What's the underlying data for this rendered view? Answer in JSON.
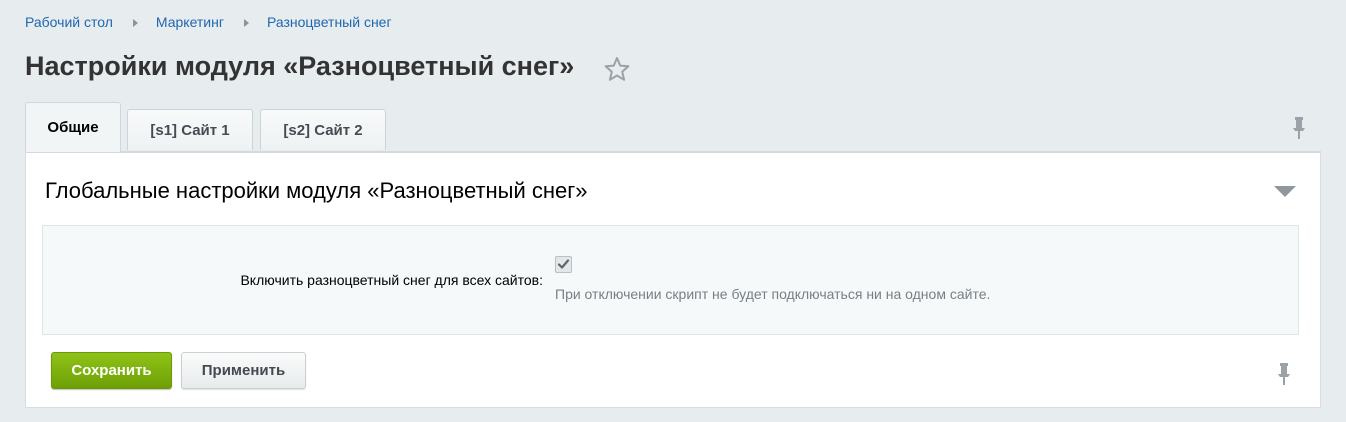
{
  "breadcrumb": {
    "items": [
      "Рабочий стол",
      "Маркетинг",
      "Разноцветный снег"
    ]
  },
  "page": {
    "title": "Настройки модуля «Разноцветный снег»"
  },
  "tabs": [
    {
      "label": "Общие",
      "active": true
    },
    {
      "label": "[s1] Сайт 1",
      "active": false
    },
    {
      "label": "[s2] Сайт 2",
      "active": false
    }
  ],
  "section": {
    "title": "Глобальные настройки модуля «Разноцветный снег»",
    "field_label": "Включить разноцветный снег для всех сайтов:",
    "checkbox_checked": true,
    "hint": "При отключении скрипт не будет подключаться ни на одном сайте."
  },
  "buttons": {
    "save_label": "Сохранить",
    "apply_label": "Применить"
  },
  "icons": {
    "favorite": "star-icon",
    "pin": "pin-icon",
    "collapse": "triangle-down-icon",
    "separator": "triangle-right-icon"
  },
  "colors": {
    "link": "#2067b0",
    "save_button": "#7fb20d",
    "background": "#e7ecee"
  }
}
